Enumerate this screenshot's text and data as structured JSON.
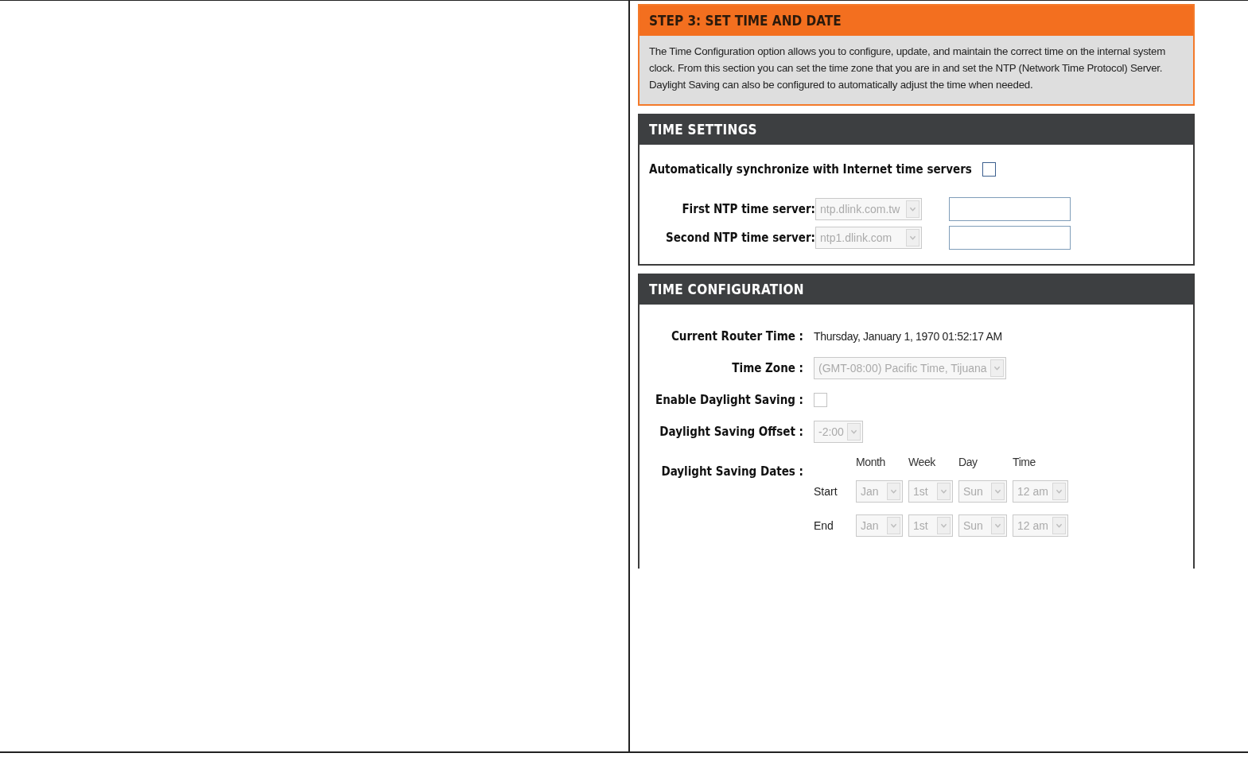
{
  "step": {
    "title": "STEP 3: SET TIME AND DATE",
    "description": "The Time Configuration option allows you to configure, update, and maintain the correct time on the internal system clock. From this section you can set the time zone that you are in and set the NTP (Network Time Protocol) Server. Daylight Saving can also be configured to automatically adjust the time when needed."
  },
  "time_settings": {
    "title": "TIME SETTINGS",
    "auto_sync": {
      "label": "Automatically synchronize with Internet time servers",
      "checked": false
    },
    "servers": [
      {
        "label": "First NTP time server:",
        "value": "ntp.dlink.com.tw",
        "disabled": true,
        "field_disabled": false
      },
      {
        "label": "Second NTP time server:",
        "value": "ntp1.dlink.com",
        "disabled": true,
        "field_disabled": false
      }
    ]
  },
  "time_configuration": {
    "title": "TIME CONFIGURATION",
    "current_time": {
      "label": "Current Router Time :",
      "value": "Thursday, January 1, 1970 01:52:17 AM"
    },
    "time_zone": {
      "label": "Time Zone :",
      "value": "(GMT-08:00) Pacific Time, Tijuana",
      "disabled": true
    },
    "daylight_saving": {
      "label": "Enable Daylight Saving :",
      "checked": false
    },
    "offset": {
      "label": "Daylight Saving Offset :",
      "value": "-2:00",
      "disabled": true
    },
    "dates": {
      "label": "Daylight Saving Dates :",
      "columns": [
        "Month",
        "Week",
        "Day",
        "Time"
      ],
      "rows": [
        {
          "label": "Start",
          "values": [
            {
              "value": "Jan",
              "disabled": true
            },
            {
              "value": "1st",
              "disabled": true
            },
            {
              "value": "Sun",
              "disabled": true
            },
            {
              "value": "12 am",
              "disabled": true
            }
          ]
        },
        {
          "label": "End",
          "values": [
            {
              "value": "Jan",
              "disabled": true
            },
            {
              "value": "1st",
              "disabled": true
            },
            {
              "value": "Sun",
              "disabled": true
            },
            {
              "value": "12 am",
              "disabled": true
            }
          ]
        }
      ]
    }
  }
}
